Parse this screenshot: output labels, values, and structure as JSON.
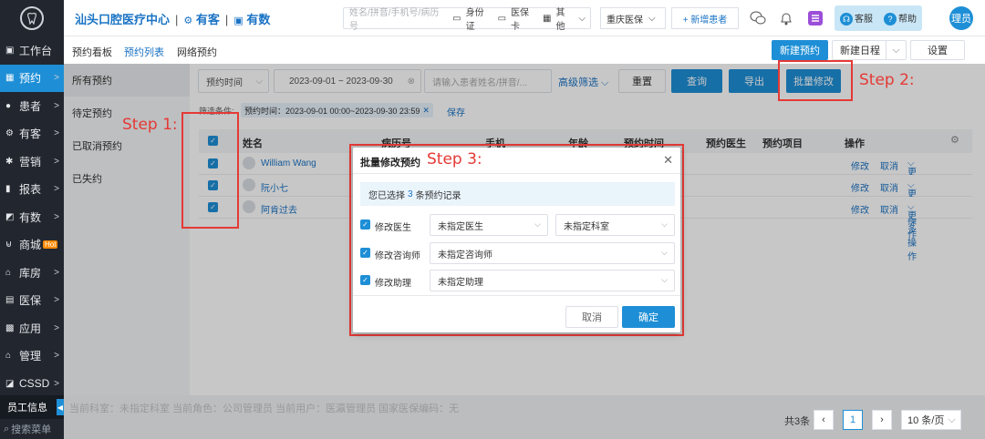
{
  "sidebar": {
    "items": [
      {
        "label": "工作台",
        "icon": "monitor-icon",
        "arrow": ""
      },
      {
        "label": "预约",
        "icon": "calendar-icon",
        "arrow": ">"
      },
      {
        "label": "患者",
        "icon": "user-icon",
        "arrow": ">"
      },
      {
        "label": "有客",
        "icon": "gear-icon",
        "arrow": ">"
      },
      {
        "label": "营销",
        "icon": "sparkle-icon",
        "arrow": ">"
      },
      {
        "label": "报表",
        "icon": "bar-chart-icon",
        "arrow": ">"
      },
      {
        "label": "有数",
        "icon": "chart-box-icon",
        "arrow": ">"
      },
      {
        "label": "商城",
        "icon": "cart-icon",
        "arrow": "",
        "badge": "Hot"
      },
      {
        "label": "库房",
        "icon": "warehouse-icon",
        "arrow": ">"
      },
      {
        "label": "医保",
        "icon": "insurance-icon",
        "arrow": ">"
      },
      {
        "label": "应用",
        "icon": "apps-icon",
        "arrow": ">"
      },
      {
        "label": "管理",
        "icon": "home-icon",
        "arrow": ">"
      },
      {
        "label": "CSSD",
        "icon": "cssd-icon",
        "arrow": ">"
      }
    ],
    "staff_label": "员工信息",
    "search_label": "搜索菜单"
  },
  "header": {
    "clinic_name": "汕头口腔医疗中心",
    "nav_youke": "有客",
    "nav_youshu": "有数",
    "search_placeholder": "姓名/拼音/手机号/病历号",
    "search_options": [
      "身份证",
      "医保卡",
      "其他"
    ],
    "city": "重庆医保",
    "add_patient": "+ 新增患者",
    "service": "客服",
    "help": "帮助",
    "user": "理员"
  },
  "subtabs": [
    "预约看板",
    "预约列表",
    "网络预约"
  ],
  "actions": {
    "new_appointment": "新建预约",
    "new_schedule": "新建日程",
    "settings": "设置"
  },
  "left_list": [
    "所有预约",
    "待定预约",
    "已取消预约",
    "已失约"
  ],
  "filters": {
    "time_type": "预约时间",
    "date_range": "2023-09-01 ~ 2023-09-30",
    "name_placeholder": "请输入患者姓名/拼音/...",
    "advanced": "高级筛选",
    "reset": "重置",
    "query": "查询",
    "export": "导出",
    "batch_edit": "批量修改",
    "condition_label": "筛选条件:",
    "condition_chip": "预约时间：2023-09-01 00:00~2023-09-30 23:59",
    "save": "保存"
  },
  "table": {
    "columns": [
      "姓名",
      "病历号",
      "手机",
      "年龄",
      "预约时间",
      "预约医生",
      "预约项目",
      "操作"
    ],
    "rows": [
      {
        "name": "William Wang",
        "actions": [
          "修改",
          "取消",
          "更多操作"
        ]
      },
      {
        "name": "阮小七",
        "actions": [
          "修改",
          "取消",
          "更多操作"
        ]
      },
      {
        "name": "阿肯过去",
        "actions": [
          "修改",
          "取消",
          "更多操作"
        ]
      }
    ]
  },
  "annotations": {
    "step1": "Step 1:",
    "step2": "Step 2:",
    "step3": "Step 3:"
  },
  "modal": {
    "title": "批量修改预约",
    "note_prefix": "您已选择",
    "note_count": "3",
    "note_suffix": "条预约记录",
    "rows": [
      {
        "label": "修改医生",
        "select1": "未指定医生",
        "select2": "未指定科室"
      },
      {
        "label": "修改咨询师",
        "select1": "未指定咨询师"
      },
      {
        "label": "修改助理",
        "select1": "未指定助理"
      }
    ],
    "cancel": "取消",
    "confirm": "确定"
  },
  "footer": {
    "info": "当前科室：未指定科室    当前角色：公司管理员    当前用户：医瀛管理员    国家医保编码：无",
    "total": "共3条",
    "page": "1",
    "page_size": "10 条/页"
  },
  "colors": {
    "accent": "#1e8fd6",
    "annotation": "#e53935",
    "sidebar": "#22272f"
  }
}
